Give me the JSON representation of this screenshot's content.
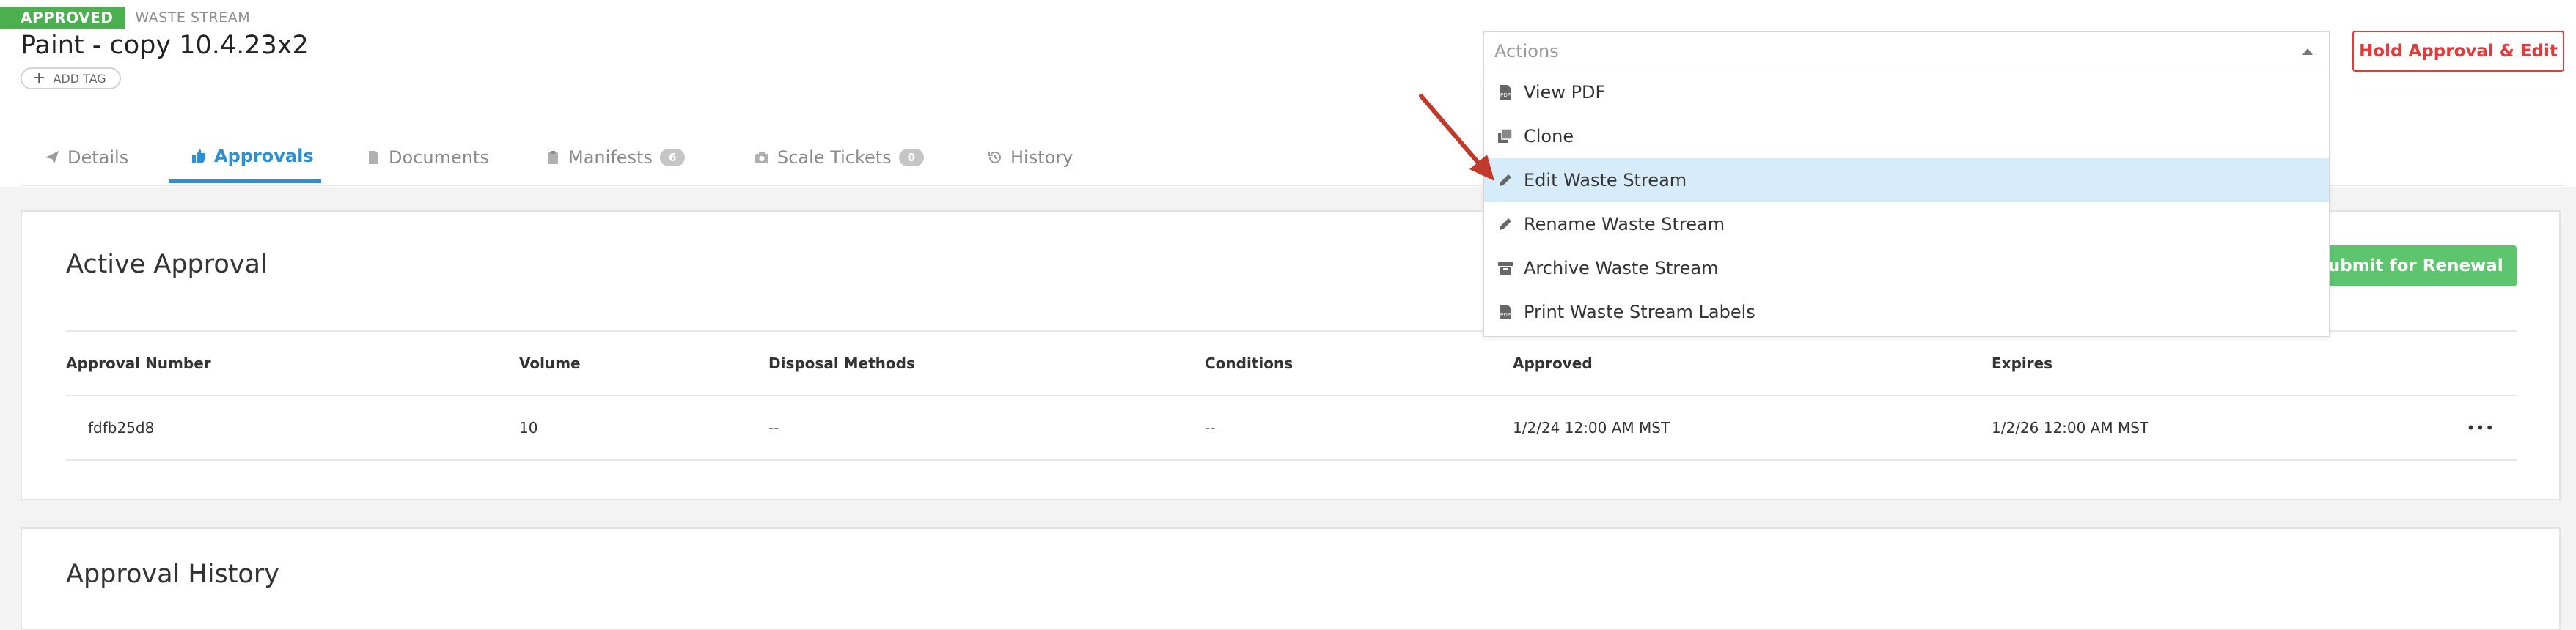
{
  "status": {
    "badge": "APPROVED",
    "type": "WASTE STREAM"
  },
  "title": "Paint - copy 10.4.23x2",
  "add_tag": {
    "label": "ADD TAG"
  },
  "tabs": [
    {
      "label": "Details",
      "icon": "paper-plane-icon"
    },
    {
      "label": "Approvals",
      "icon": "thumbs-up-icon",
      "active": true
    },
    {
      "label": "Documents",
      "icon": "document-icon"
    },
    {
      "label": "Manifests",
      "icon": "clipboard-icon",
      "count": "6"
    },
    {
      "label": "Scale Tickets",
      "icon": "camera-icon",
      "count": "0"
    },
    {
      "label": "History",
      "icon": "history-icon"
    }
  ],
  "actions": {
    "placeholder": "Actions",
    "items": [
      {
        "label": "View PDF",
        "icon": "pdf-file-icon"
      },
      {
        "label": "Clone",
        "icon": "clone-icon"
      },
      {
        "label": "Edit Waste Stream",
        "icon": "pencil-icon",
        "highlighted": true
      },
      {
        "label": "Rename Waste Stream",
        "icon": "pencil-icon"
      },
      {
        "label": "Archive Waste Stream",
        "icon": "archive-icon"
      },
      {
        "label": "Print Waste Stream Labels",
        "icon": "pdf-file-icon"
      }
    ]
  },
  "hold_button": "Hold Approval & Edit",
  "active_approval": {
    "title": "Active Approval",
    "submit_label": "& Submit for Renewal",
    "columns": [
      "Approval Number",
      "Volume",
      "Disposal Methods",
      "Conditions",
      "Approved",
      "Expires"
    ],
    "rows": [
      {
        "approval_number": "fdfb25d8",
        "volume": "10",
        "disposal_methods": "--",
        "conditions": "--",
        "approved": "1/2/24 12:00 AM MST",
        "expires": "1/2/26 12:00 AM MST",
        "menu": "•••"
      }
    ]
  },
  "approval_history": {
    "title": "Approval History"
  },
  "colors": {
    "approved": "#4caf50",
    "accent": "#2a8fd6",
    "submit": "#5cc56d",
    "danger": "#e23b3b",
    "highlight": "#d6ecfa",
    "annotation_arrow": "#c0392b"
  }
}
